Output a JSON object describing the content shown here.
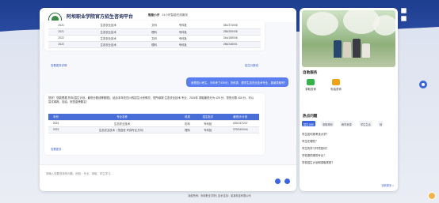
{
  "header": {
    "title": "阿坝职业学院官方招生咨询平台",
    "subtitle_label": "智能小汐",
    "subtitle_text": "24小时智能在线服务"
  },
  "table1": {
    "rows": [
      [
        "2021",
        "生态农业技术",
        "文科",
        "专科批",
        "381/374/0/8"
      ],
      [
        "2021",
        "生态农业技术",
        "理科",
        "专科批",
        "285/250/0/8"
      ],
      [
        "2022",
        "生态农业技术",
        "文科",
        "专科批",
        "344/168/0/8"
      ],
      [
        "2022",
        "生态农业技术",
        "理科",
        "专科批",
        "286/248/0/1"
      ]
    ],
    "link_more": "查看更多详情",
    "link_scores": "招生分数线"
  },
  "user_message": "我是四川考生，今年考了430分，历科类，想学生态农业技术专业，能被录取吗？",
  "ai_reply": {
    "text": "您好！您能根据 历年(招生计划、最低分数线等数据)，结合本年在四川的招生计划情况，您所填报 生态农业技术 专业，2024年 录取最低分为 425 分，您的分数 430 分，可以尝试填报，加油，祝您金榜题名！",
    "headers": [
      "年份",
      "专业名称",
      "科类",
      "招生批次",
      "最低分/计划"
    ],
    "rows": [
      [
        "2024",
        "生态农业技术",
        "历科",
        "专科批",
        "425/137/247"
      ],
      [
        "2023",
        "生态农业技术（茂县班 环保专业方向）",
        "理科",
        "专科批",
        "379/340/044"
      ]
    ],
    "link_more": "查看更多"
  },
  "input": {
    "placeholder": "请输入您要咨询的问题，例如：专业、录取、学生学习..."
  },
  "right": {
    "services_title": "自助服务",
    "services": [
      {
        "label": "录取查询",
        "icon": "wechat-icon",
        "color": "#36b24a"
      },
      {
        "label": "电话咨询",
        "icon": "phone-icon",
        "color": "#f0a21a"
      }
    ],
    "hot_title": "热点问题",
    "tabs": [
      "招生计划",
      "录取规则",
      "教学资源",
      "学生生活",
      "就"
    ],
    "questions": [
      "学生如何报考该大学？",
      "学生在哪些？",
      "学生的学习环境如何？",
      "学校提供哪些专业？",
      "学校招生计划和录取规则？"
    ],
    "more_label": "查看更多 >"
  },
  "footer": "版权所有：阿坝职业学院 | 技术支持：某某科技有限公司",
  "colors": {
    "primary": "#3b64e0",
    "user_bubble": "#5b7ff0",
    "header_bg": "#1d3d8f"
  }
}
